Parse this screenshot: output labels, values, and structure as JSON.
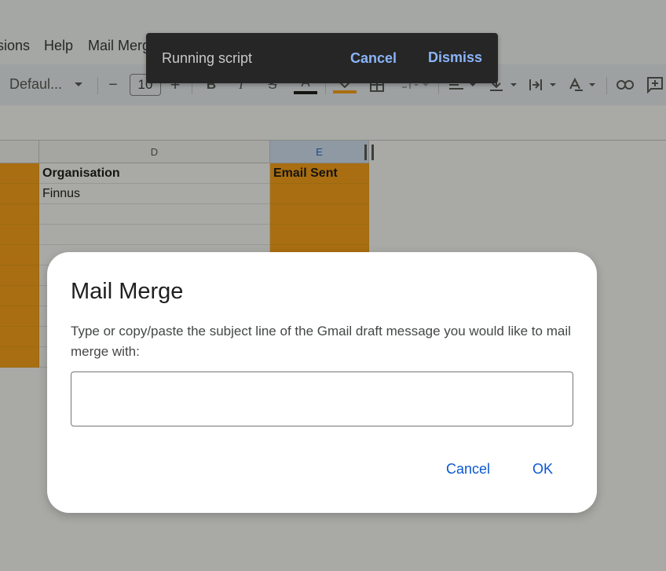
{
  "menu": {
    "items": [
      "sions",
      "Help",
      "Mail Merg"
    ]
  },
  "toolbar": {
    "font_name": "Defaul...",
    "font_size": "10",
    "minus_label": "−",
    "plus_label": "+",
    "bold_label": "B",
    "italic_label": "I",
    "strike_label": "S",
    "text_color_label": "A",
    "text_color": "#000000",
    "fill_color": "#ff9900"
  },
  "sheet": {
    "columns": [
      {
        "label": "D",
        "selected": false
      },
      {
        "label": "E",
        "selected": true
      }
    ],
    "rows": [
      {
        "d": "Organisation",
        "e": "Email Sent",
        "header": true
      },
      {
        "d": "Finnus",
        "e": ""
      },
      {
        "d": "",
        "e": ""
      },
      {
        "d": "",
        "e": ""
      },
      {
        "d": "",
        "e": ""
      },
      {
        "d": "",
        "e": ""
      },
      {
        "d": "",
        "e": ""
      },
      {
        "d": "",
        "e": ""
      },
      {
        "d": "",
        "e": ""
      },
      {
        "d": "",
        "e": ""
      }
    ],
    "highlight_color": "#ff9900"
  },
  "snackbar": {
    "text": "Running script",
    "cancel_label": "Cancel",
    "dismiss_label": "Dismiss"
  },
  "dialog": {
    "title": "Mail Merge",
    "body": "Type or copy/paste the subject line of the Gmail draft message you would like to mail merge with:",
    "input_value": "",
    "cancel_label": "Cancel",
    "ok_label": "OK"
  }
}
